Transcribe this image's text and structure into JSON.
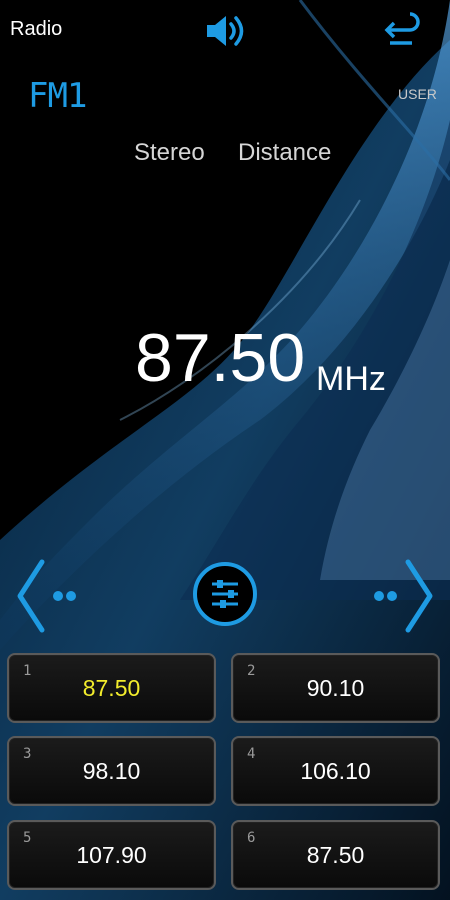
{
  "header": {
    "title": "Radio",
    "speaker_icon": "speaker-volume-icon",
    "back_icon": "return-icon"
  },
  "tuner": {
    "band": "FM1",
    "mode": "USER",
    "stereo": "Stereo",
    "distance": "Distance",
    "frequency": "87.50",
    "unit": "MHz"
  },
  "controls": {
    "prev_icon": "seek-prev-icon",
    "next_icon": "seek-next-icon",
    "eq_icon": "equalizer-icon"
  },
  "presets": [
    {
      "number": "1",
      "value": "87.50",
      "active": true
    },
    {
      "number": "2",
      "value": "90.10",
      "active": false
    },
    {
      "number": "3",
      "value": "98.10",
      "active": false
    },
    {
      "number": "4",
      "value": "106.10",
      "active": false
    },
    {
      "number": "5",
      "value": "107.90",
      "active": false
    },
    {
      "number": "6",
      "value": "87.50",
      "active": false
    }
  ],
  "colors": {
    "accent": "#1e9be3",
    "active_preset": "#f2ec2c",
    "background": "#000000"
  }
}
